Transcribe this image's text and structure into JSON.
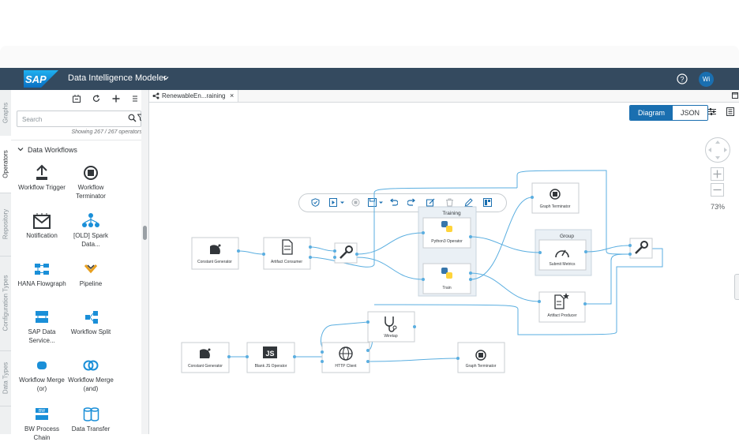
{
  "shell": {
    "logo_text": "SAP",
    "app_title": "Data Intelligence Modeler",
    "avatar_initials": "Wi",
    "colors": {
      "shell": "#344a5f",
      "accent": "#1a6fb0",
      "link": "#5aaee0"
    }
  },
  "vertical_tabs": [
    {
      "label": "Graphs"
    },
    {
      "label": "Operators"
    },
    {
      "label": "Repository"
    },
    {
      "label": "Configuration Types"
    },
    {
      "label": "Data Types"
    }
  ],
  "sidebar": {
    "toolbar_icons": [
      "import-icon",
      "refresh-icon",
      "add-icon",
      "list-icon"
    ],
    "search_placeholder": "Search",
    "count_text": "Showing 267 / 267 operators",
    "category": "Data Workflows",
    "operators": [
      {
        "name": "Workflow Trigger",
        "icon": "workflow-trigger-icon"
      },
      {
        "name": "Workflow Terminator",
        "icon": "workflow-terminator-icon"
      },
      {
        "name": "Notification",
        "icon": "notification-icon"
      },
      {
        "name": "[OLD] Spark Data...",
        "icon": "spark-icon"
      },
      {
        "name": "HANA Flowgraph",
        "icon": "hana-flowgraph-icon"
      },
      {
        "name": "Pipeline",
        "icon": "pipeline-icon"
      },
      {
        "name": "SAP Data Service...",
        "icon": "data-services-icon"
      },
      {
        "name": "Workflow Split",
        "icon": "workflow-split-icon"
      },
      {
        "name": "Workflow Merge (or)",
        "icon": "merge-or-icon"
      },
      {
        "name": "Workflow Merge (and)",
        "icon": "merge-and-icon"
      },
      {
        "name": "BW Process Chain",
        "icon": "bw-process-icon"
      },
      {
        "name": "Data Transfer",
        "icon": "data-transfer-icon"
      }
    ]
  },
  "editor": {
    "tab_title": "RenewableEn...raining",
    "tab_close": "×",
    "toolbar_icons": [
      "validate-icon",
      "run-icon",
      "stop-icon",
      "save-icon",
      "undo-icon",
      "redo-icon",
      "edit-icon",
      "delete-icon",
      "pen-icon",
      "layout-icon"
    ],
    "view_modes": [
      "Diagram",
      "JSON"
    ],
    "active_view": "Diagram",
    "zoom": "73%"
  },
  "graph": {
    "groups": [
      {
        "label": "Training"
      },
      {
        "label": "Group"
      }
    ],
    "nodes": [
      {
        "label": "Constant Generator",
        "icon": "satellite-dish-icon"
      },
      {
        "label": "Artifact Consumer",
        "icon": "document-icon"
      },
      {
        "label": "",
        "icon": "wrench-icon"
      },
      {
        "label": "Python3 Operator",
        "icon": "python-icon"
      },
      {
        "label": "Train",
        "icon": "python-icon"
      },
      {
        "label": "Graph Terminator",
        "icon": "terminator-icon"
      },
      {
        "label": "Submit Metrics",
        "icon": "gauge-icon"
      },
      {
        "label": "Artifact Producer",
        "icon": "document-star-icon"
      },
      {
        "label": "",
        "icon": "wrench-icon"
      },
      {
        "label": "Constant Generator",
        "icon": "satellite-dish-icon"
      },
      {
        "label": "Blank JS Operator",
        "icon": "js-icon"
      },
      {
        "label": "HTTP Client",
        "icon": "globe-icon"
      },
      {
        "label": "Wiretap",
        "icon": "stethoscope-icon"
      },
      {
        "label": "Graph Terminator",
        "icon": "terminator-icon"
      }
    ]
  }
}
